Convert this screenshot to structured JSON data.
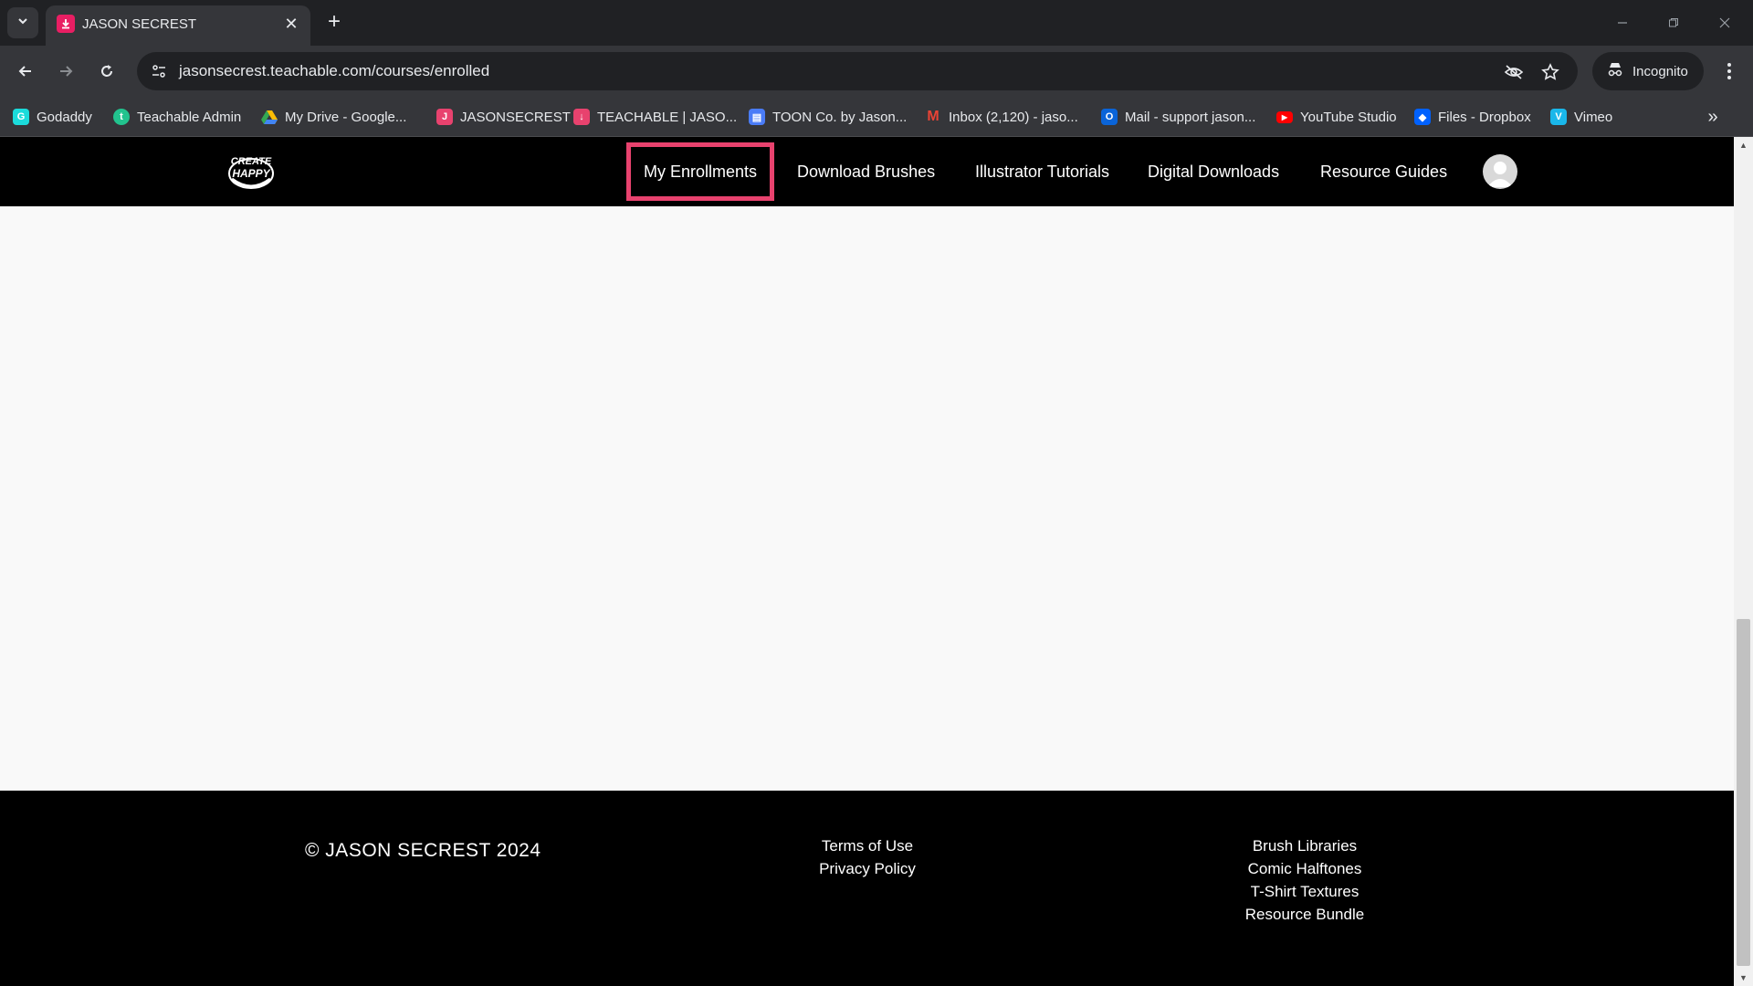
{
  "browser": {
    "tab_title": "JASON SECREST",
    "url": "jasonsecrest.teachable.com/courses/enrolled",
    "incognito_label": "Incognito",
    "bookmarks": [
      {
        "label": "Godaddy",
        "icon": "godaddy-icon",
        "color": "#1bdbdb"
      },
      {
        "label": "Teachable Admin",
        "icon": "teachable-icon",
        "color": "#22c38e"
      },
      {
        "label": "My Drive - Google...",
        "icon": "google-drive-icon",
        "color": "#fbbc04"
      },
      {
        "label": "JASONSECREST",
        "icon": "jasonsecrest-icon",
        "color": "#e8426e"
      },
      {
        "label": "TEACHABLE | JASO...",
        "icon": "teachable-download-icon",
        "color": "#e8426e"
      },
      {
        "label": "TOON Co. by Jason...",
        "icon": "shop-icon",
        "color": "#4a7cf7"
      },
      {
        "label": "Inbox (2,120) - jaso...",
        "icon": "gmail-icon",
        "color": "#ea4335"
      },
      {
        "label": "Mail - support jason...",
        "icon": "outlook-icon",
        "color": "#0a64d8"
      },
      {
        "label": "YouTube Studio",
        "icon": "youtube-icon",
        "color": "#ff0000"
      },
      {
        "label": "Files - Dropbox",
        "icon": "dropbox-icon",
        "color": "#0061fe"
      },
      {
        "label": "Vimeo",
        "icon": "vimeo-icon",
        "color": "#1ab7ea"
      }
    ]
  },
  "site": {
    "logo_alt": "CREATE HAPPY",
    "nav": [
      {
        "label": "My Enrollments",
        "active": true
      },
      {
        "label": "Download Brushes"
      },
      {
        "label": "Illustrator Tutorials"
      },
      {
        "label": "Digital Downloads"
      },
      {
        "label": "Resource Guides"
      }
    ],
    "accent_color": "#e8426e"
  },
  "footer": {
    "copyright": "© JASON SECREST 2024",
    "legal_links": [
      "Terms of Use",
      "Privacy Policy"
    ],
    "product_links": [
      "Brush Libraries",
      "Comic Halftones",
      "T-Shirt Textures",
      "Resource Bundle"
    ]
  }
}
